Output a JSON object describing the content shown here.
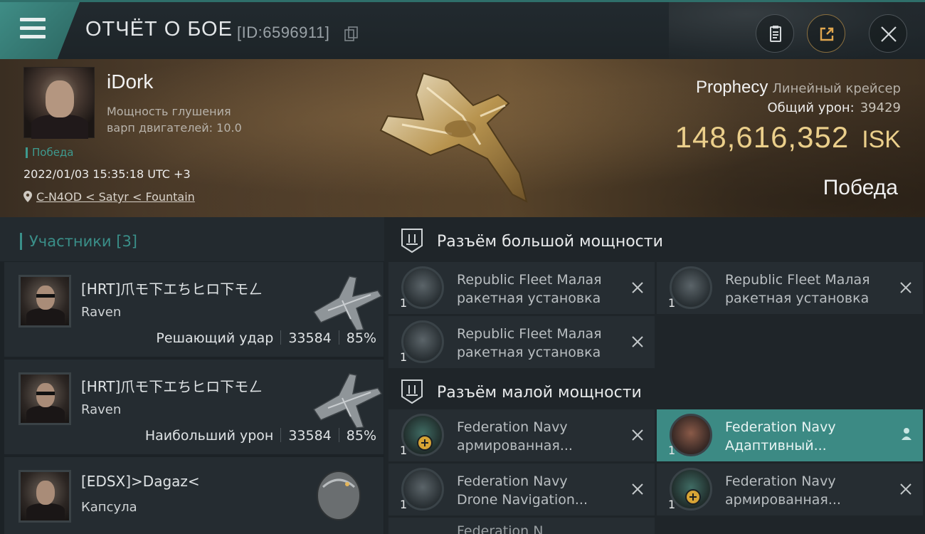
{
  "header": {
    "title": "ОТЧЁТ О БОЕ",
    "report_id": "[ID:6596911]",
    "icons": [
      "menu-icon",
      "copy-icon",
      "clipboard-icon",
      "share-icon",
      "close-icon"
    ]
  },
  "victim": {
    "name": "iDork",
    "stat_line1": "Мощность глушения",
    "stat_line2": "варп двигателей: 10.0",
    "status": "Победа",
    "datetime": "2022/01/03 15:35:18 UTC +3",
    "location": "C-N4OD < Satyr < Fountain",
    "ship_name": "Prophecy",
    "ship_class": "Линейный крейсер",
    "total_damage_label": "Общий урон:",
    "total_damage": "39429",
    "isk_value": "148,616,352",
    "isk_unit": "ISK",
    "result": "Победа"
  },
  "participants": {
    "label": "Участники",
    "count": "[3]",
    "items": [
      {
        "name": "[HRT]爪モ下エちヒロ下モㄥ",
        "ship": "Raven",
        "role": "Решающий удар",
        "damage": "33584",
        "percent": "85%"
      },
      {
        "name": "[HRT]爪モ下エちヒロ下モㄥ",
        "ship": "Raven",
        "role": "Наибольший урон",
        "damage": "33584",
        "percent": "85%"
      },
      {
        "name": "[EDSX]>Dagaz<",
        "ship": "Капсула"
      }
    ]
  },
  "fitting": {
    "high_title": "Разъём большой мощности",
    "low_title": "Разъём малой мощности",
    "high_slots": [
      {
        "line1": "Republic Fleet Малая",
        "line2": "ракетная установка",
        "qty": "1"
      },
      {
        "line1": "Republic Fleet Малая",
        "line2": "ракетная установка",
        "qty": "1"
      },
      {
        "line1": "Republic Fleet Малая",
        "line2": "ракетная установка",
        "qty": "1"
      }
    ],
    "low_slots": [
      {
        "line1": "Federation Navy",
        "line2": "армированная...",
        "qty": "1"
      },
      {
        "line1": "Federation Navy",
        "line2": "Адаптивный...",
        "qty": "1"
      },
      {
        "line1": "Federation Navy",
        "line2": "Drone Navigation...",
        "qty": "1"
      },
      {
        "line1": "Federation Navy",
        "line2": "армированная...",
        "qty": "1"
      }
    ],
    "partial_line": "Federation N"
  },
  "colors": {
    "accent": "#3c8a84",
    "isk": "#ebcf8b",
    "status": "#3e9a8f"
  }
}
